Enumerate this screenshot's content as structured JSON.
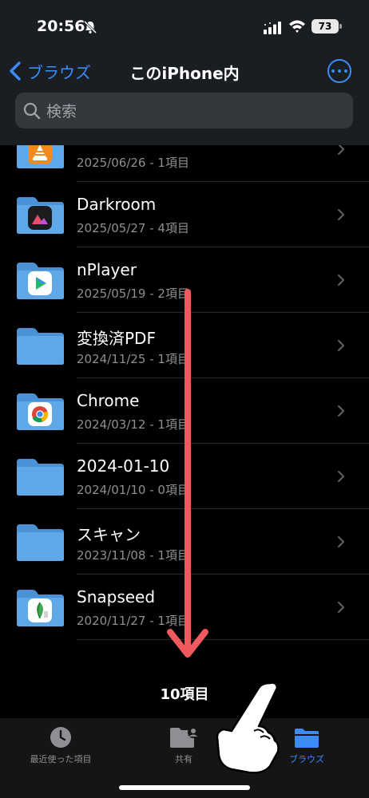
{
  "status_bar": {
    "time": "20:56",
    "battery": "73",
    "icons": [
      "bell-slash-icon",
      "cellular-signal-icon",
      "wifi-icon",
      "battery-icon"
    ]
  },
  "nav": {
    "back_label": "ブラウズ",
    "title": "このiPhone内",
    "more_icon": "ellipsis-circle-icon"
  },
  "search": {
    "placeholder": "検索",
    "icon": "magnifier-icon"
  },
  "files": [
    {
      "name": "VLC",
      "meta": "2025/06/26 - 1項目",
      "badge": "vlc"
    },
    {
      "name": "Darkroom",
      "meta": "2025/05/27 - 4項目",
      "badge": "darkroom"
    },
    {
      "name": "nPlayer",
      "meta": "2025/05/19 - 2項目",
      "badge": "nplayer"
    },
    {
      "name": "変換済PDF",
      "meta": "2024/11/25 - 1項目",
      "badge": "none"
    },
    {
      "name": "Chrome",
      "meta": "2024/03/12 - 1項目",
      "badge": "chrome"
    },
    {
      "name": "2024-01-10",
      "meta": "2024/01/10 - 0項目",
      "badge": "none"
    },
    {
      "name": "スキャン",
      "meta": "2023/11/08 - 1項目",
      "badge": "none"
    },
    {
      "name": "Snapseed",
      "meta": "2020/11/27 - 1項目",
      "badge": "snapseed"
    }
  ],
  "item_count": "10項目",
  "tabs": {
    "recent": "最近使った項目",
    "shared": "共有",
    "browse": "ブラウズ"
  },
  "colors": {
    "accent": "#3c8cf7",
    "folder": "#5fa8e8",
    "annotation_arrow": "#f05a5e"
  }
}
